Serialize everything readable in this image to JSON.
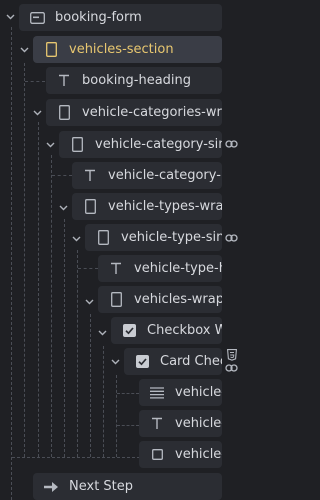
{
  "tree": {
    "booking_form": "booking-form",
    "vehicles_section": "vehicles-section",
    "booking_heading": "booking-heading",
    "vehicle_categories_wrapper": "vehicle-categories-wrapper",
    "vehicle_category_single": "vehicle-category-single-w",
    "vehicle_category_heading": "vehicle-category-headi",
    "vehicle_types_wrapper": "vehicle-types-wrapper",
    "vehicle_type_single": "vehicle-type-single-w",
    "vehicle_type_heading": "vehicle-type-headi",
    "vehicles_wrapper": "vehicles-wrapper",
    "checkbox_wrapper": "Checkbox Wrapp",
    "card_checkbox": "Card Checkbo",
    "vehicle_label": "vehicle-labe",
    "vehicle_title": "vehicle-title",
    "vehicle_body": "vehicle-boo",
    "next_step": "Next Step"
  },
  "colors": {
    "background": "#1f2024",
    "node": "#2b2d33",
    "selected_node": "#3a3d46",
    "selected_text": "#e8c770"
  }
}
